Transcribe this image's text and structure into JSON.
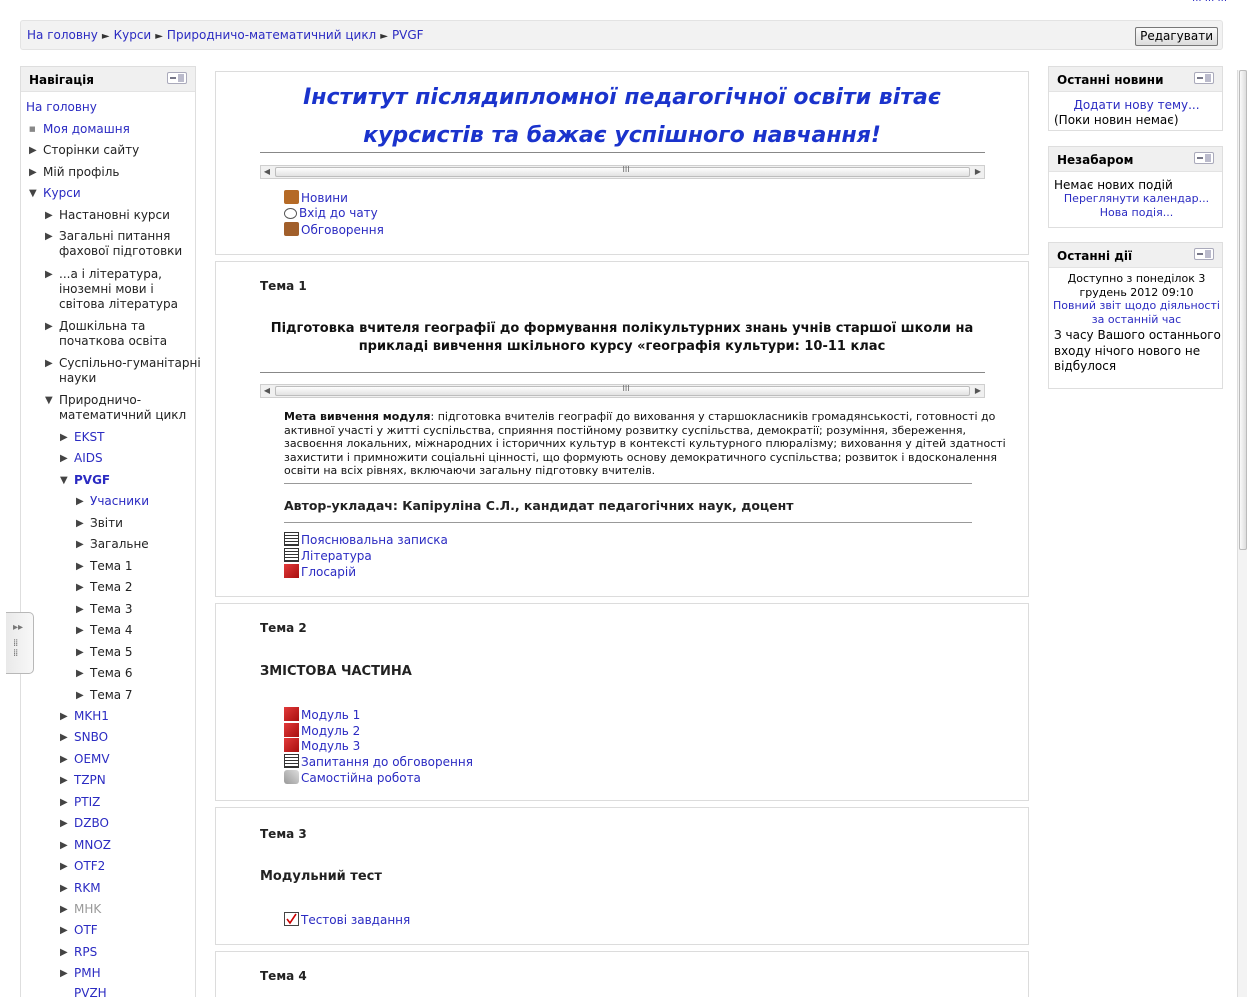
{
  "breadcrumb": {
    "items": [
      "На головну",
      "Курси",
      "Природничо-математичний цикл",
      "PVGF"
    ],
    "separator": "►"
  },
  "toolbar": {
    "edit_label": "Редагувати"
  },
  "navigation": {
    "title": "Навігація",
    "home": "На головну",
    "my_home": "Моя домашня",
    "site_pages": "Сторінки сайту",
    "my_profile": "Мій профіль",
    "courses": "Курси",
    "categories": {
      "c1": "Настановні курси",
      "c2a": "Загальні питання",
      "c2b": "фахової підготовки",
      "c3a": "...а і література,",
      "c3b": "іноземні мови і",
      "c3c": "світова література",
      "c4a": "Дошкільна та",
      "c4b": "початкова освіта",
      "c5a": "Суспільно-гуманітарні",
      "c5b": "науки",
      "c6a": "Природничо-",
      "c6b": "математичний цикл"
    },
    "subcourses": [
      "EKST",
      "AIDS",
      "PVGF"
    ],
    "pvgf_items": [
      "Учасники",
      "Звіти",
      "Загальне",
      "Тема 1",
      "Тема 2",
      "Тема 3",
      "Тема 4",
      "Тема 5",
      "Тема 6",
      "Тема 7"
    ],
    "other_courses": [
      "MKH1",
      "SNBO",
      "OEMV",
      "TZPN",
      "PTIZ",
      "DZBO",
      "MNOZ",
      "OTF2",
      "RKM",
      "MHK",
      "OTF",
      "RPS",
      "PMH",
      "PVZH"
    ]
  },
  "welcome": {
    "line1": "Інститут післядипломної педагогічної освіти вітає",
    "line2": "курсистів та бажає успішного навчання!",
    "links": [
      "Новини",
      "Вхід до чату",
      "Обговорення"
    ]
  },
  "topic1": {
    "label": "Тема 1",
    "heading1": "Підготовка вчителя географії до формування полікультурних знань учнів старшої школи на",
    "heading2": "прикладі вивчення шкільного курсу «географія культури: 10-11 клас",
    "goal_label": "Мета вивчення модуля",
    "goal_l1": ": підготовка вчителів географії до виховання у старшокласників громадянськості, готовності до",
    "goal_l2": "активної участі у житті суспільства, сприяння постійному розвитку суспільства, демократії; розуміння, збереження,",
    "goal_l3": "засвоєння локальних, міжнародних і історичних культур в контексті культурного плюралізму; виховання у дітей здатності",
    "goal_l4": "захистити і примножити соціальні цінності, що формують основу демократичного суспільства; розвиток і вдосконалення",
    "goal_l5": "освіти на всіх рівнях, включаючи загальну підготовку вчителів.",
    "author": "Автор-укладач: Капіруліна С.Л., кандидат педагогічних наук, доцент",
    "links": [
      "Пояснювальна записка",
      "Література",
      "Глосарій"
    ]
  },
  "topic2": {
    "label": "Тема 2",
    "heading": "ЗМІСТОВА ЧАСТИНА",
    "links": [
      "Модуль 1",
      "Модуль 2",
      "Модуль 3",
      "Запитання до обговорення",
      "Самостійна робота"
    ]
  },
  "topic3": {
    "label": "Тема 3",
    "heading": "Модульний тест",
    "links": [
      "Тестові завдання"
    ]
  },
  "topic4": {
    "label": "Тема 4"
  },
  "news_block": {
    "title": "Останні новини",
    "add_topic": "Додати нову тему...",
    "empty": "(Поки новин немає)"
  },
  "upcoming_block": {
    "title": "Незабаром",
    "none": "Немає нових подій",
    "calendar": "Переглянути календар...",
    "new_event": "Нова подія..."
  },
  "activity_block": {
    "title": "Останні дії",
    "since1": "Доступно з понеділок 3",
    "since2": "грудень 2012 09:10",
    "report1": "Повний звіт щодо діяльності",
    "report2": "за останній час",
    "nothing1": "З часу Вашого останнього",
    "nothing2": "входу нічого нового не",
    "nothing3": "відбулося"
  },
  "colors": {
    "link": "#2b2bc2",
    "welcome": "#1a33cc"
  }
}
